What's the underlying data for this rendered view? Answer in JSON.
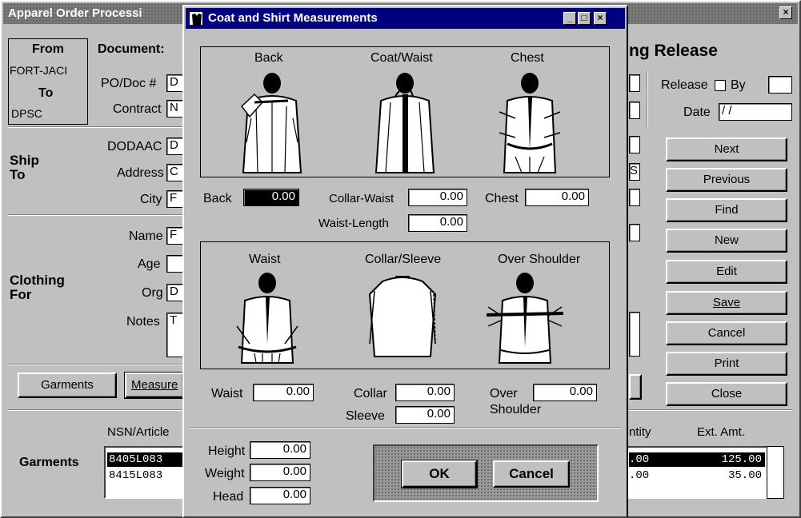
{
  "main_window": {
    "title": "Apparel Order Processi",
    "header": {
      "from": "From",
      "from_value": "FORT-JACI",
      "to": "To",
      "to_value": "DPSC",
      "document": "Document:",
      "right_title": "ng Release"
    },
    "doc_labels": {
      "po_doc": "PO/Doc #",
      "po_doc_value": "D",
      "contract": "Contract",
      "contract_value": "N"
    },
    "release": {
      "label": "Release",
      "by": "By",
      "date": "Date",
      "date_value": "/ /"
    },
    "ship_to": {
      "label": "Ship\nTo",
      "dodaac": "DODAAC",
      "dodaac_value": "D",
      "address": "Address",
      "address_value": "C",
      "city": "City",
      "city_value": "F",
      "right_value": "S"
    },
    "clothing_for": {
      "label": "Clothing\nFor",
      "name": "Name",
      "name_value": "F",
      "age": "Age",
      "org": "Org",
      "org_value": "D",
      "notes": "Notes",
      "notes_value": "T"
    },
    "nav_buttons": [
      {
        "label": "Next"
      },
      {
        "label": "Previous"
      },
      {
        "label": "Find"
      },
      {
        "label": "New"
      },
      {
        "label": "Edit"
      },
      {
        "label": "Save"
      },
      {
        "label": "Cancel"
      },
      {
        "label": "Print"
      },
      {
        "label": "Close"
      }
    ],
    "tabs": {
      "garments": "Garments",
      "measure": "Measure"
    },
    "garments_table": {
      "label": "Garments",
      "headers": {
        "nsn": "NSN/Article",
        "quantity": "ntity",
        "ext_amt": "Ext. Amt."
      },
      "rows": [
        {
          "nsn": "8405L083",
          "qty": ".00",
          "amt": "125.00",
          "selected": true
        },
        {
          "nsn": "8415L083",
          "qty": ".00",
          "amt": "35.00",
          "selected": false
        }
      ]
    }
  },
  "dialog": {
    "title": "Coat and Shirt Measurements",
    "icon": "shirt-icon",
    "top_figures": {
      "back": "Back",
      "coat_waist": "Coat/Waist",
      "chest": "Chest"
    },
    "top_fields": {
      "back_label": "Back",
      "back_value": "0.00",
      "collar_waist_label": "Collar-Waist",
      "collar_waist_value": "0.00",
      "chest_label": "Chest",
      "chest_value": "0.00",
      "waist_length_label": "Waist-Length",
      "waist_length_value": "0.00"
    },
    "bottom_figures": {
      "waist": "Waist",
      "collar_sleeve": "Collar/Sleeve",
      "over_shoulder": "Over Shoulder"
    },
    "bottom_fields": {
      "waist_label": "Waist",
      "waist_value": "0.00",
      "collar_label": "Collar",
      "collar_value": "0.00",
      "sleeve_label": "Sleeve",
      "sleeve_value": "0.00",
      "over_label": "Over",
      "shoulder_label": "Shoulder",
      "over_shoulder_value": "0.00"
    },
    "body_fields": {
      "height_label": "Height",
      "height_value": "0.00",
      "weight_label": "Weight",
      "weight_value": "0.00",
      "head_label": "Head",
      "head_value": "0.00"
    },
    "buttons": {
      "ok": "OK",
      "cancel": "Cancel"
    }
  }
}
